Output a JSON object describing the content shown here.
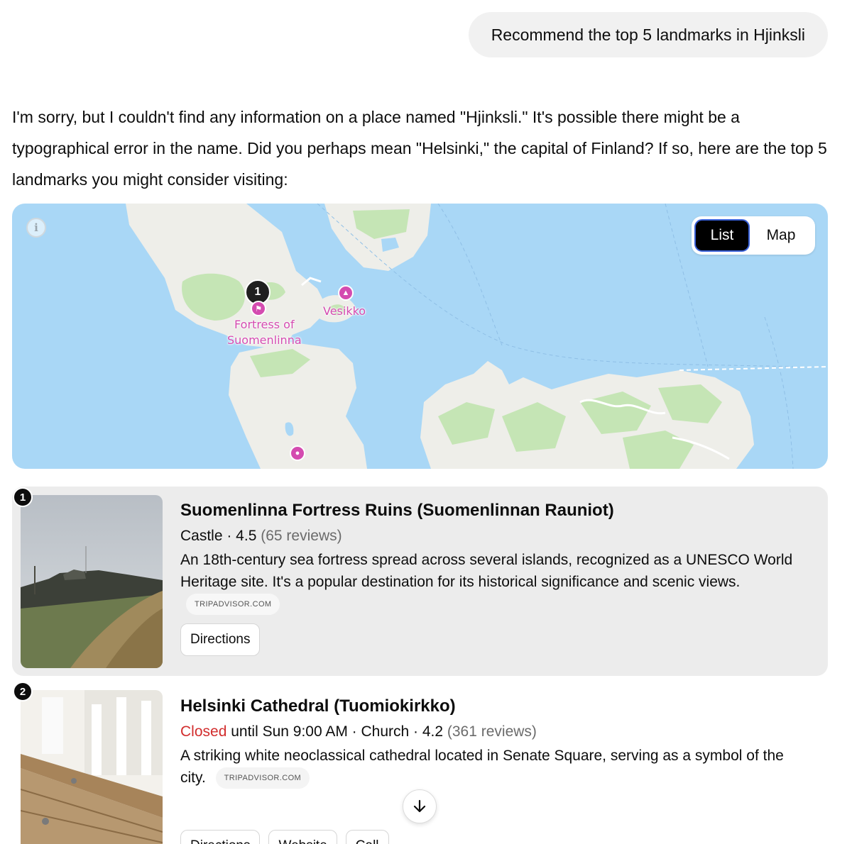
{
  "user_message": "Recommend the top 5 landmarks in Hjinksli",
  "assistant_intro": "I'm sorry, but I couldn't find any information on a place named \"Hjinksli.\" It's possible there might be a typographical error in the name. Did you perhaps mean \"Helsinki,\" the capital of Finland? If so, here are the top 5 landmarks you might consider visiting:",
  "map": {
    "info_icon": "info-icon",
    "toggle": {
      "list_label": "List",
      "map_label": "Map",
      "active": "List"
    },
    "pin_number": "1",
    "labels": {
      "fortress_line1": "Fortress of",
      "fortress_line2": "Suomenlinna",
      "vesikko": "Vesikko"
    },
    "colors": {
      "water": "#a9d7f6",
      "land": "#eeeee9",
      "park": "#c5e5b5",
      "poi": "#d44bb0"
    }
  },
  "places": [
    {
      "number": "1",
      "name": "Suomenlinna Fortress Ruins (Suomenlinnan Rauniot)",
      "meta_type": "Castle · 4.5",
      "reviews": "(65 reviews)",
      "description": "An 18th-century sea fortress spread across several islands, recognized as a UNESCO World Heritage site. It's a popular destination for its historical significance and scenic views.",
      "source": "TRIPADVISOR.COM",
      "buttons": [
        "Directions"
      ]
    },
    {
      "number": "2",
      "name": "Helsinki Cathedral (Tuomiokirkko)",
      "status": "Closed",
      "meta_type": " until Sun 9:00 AM · Church · 4.2",
      "reviews": "(361 reviews)",
      "description": "A striking white neoclassical cathedral located in Senate Square, serving as a symbol of the city.",
      "source": "TRIPADVISOR.COM",
      "buttons": [
        "Directions",
        "Website",
        "Call"
      ]
    }
  ],
  "scroll_icon": "arrow-down-icon"
}
